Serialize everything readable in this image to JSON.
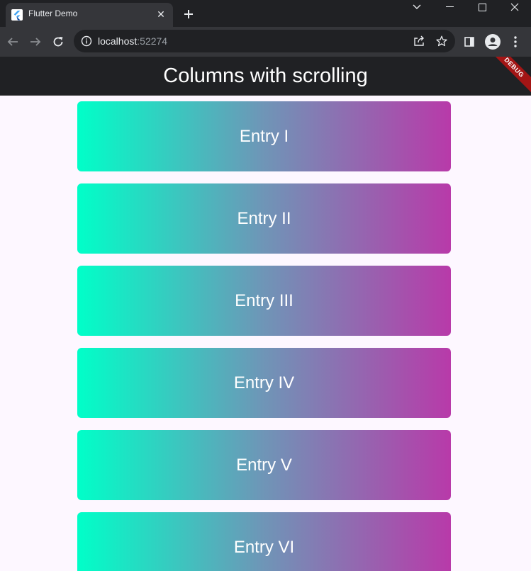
{
  "browser": {
    "tab_title": "Flutter Demo",
    "close_tab_glyph": "✕",
    "url_host": "localhost",
    "url_port": ":52274"
  },
  "app": {
    "title": "Columns with scrolling",
    "debug_banner": "DEBUG"
  },
  "colors": {
    "gradient_start": "#00ffc8",
    "gradient_end": "#b83aa9",
    "debug_banner": "#a31515",
    "app_bar": "#202124",
    "background": "#fdf7ff"
  },
  "entries": [
    {
      "label": "Entry I"
    },
    {
      "label": "Entry II"
    },
    {
      "label": "Entry III"
    },
    {
      "label": "Entry IV"
    },
    {
      "label": "Entry V"
    },
    {
      "label": "Entry VI"
    }
  ],
  "icons": [
    "flutter-icon",
    "close-icon",
    "plus-icon",
    "chevron-down-icon",
    "minimize-icon",
    "maximize-icon",
    "close-window-icon",
    "back-arrow-icon",
    "forward-arrow-icon",
    "reload-icon",
    "info-icon",
    "share-icon",
    "star-icon",
    "side-panel-icon",
    "profile-icon",
    "kebab-menu-icon"
  ]
}
